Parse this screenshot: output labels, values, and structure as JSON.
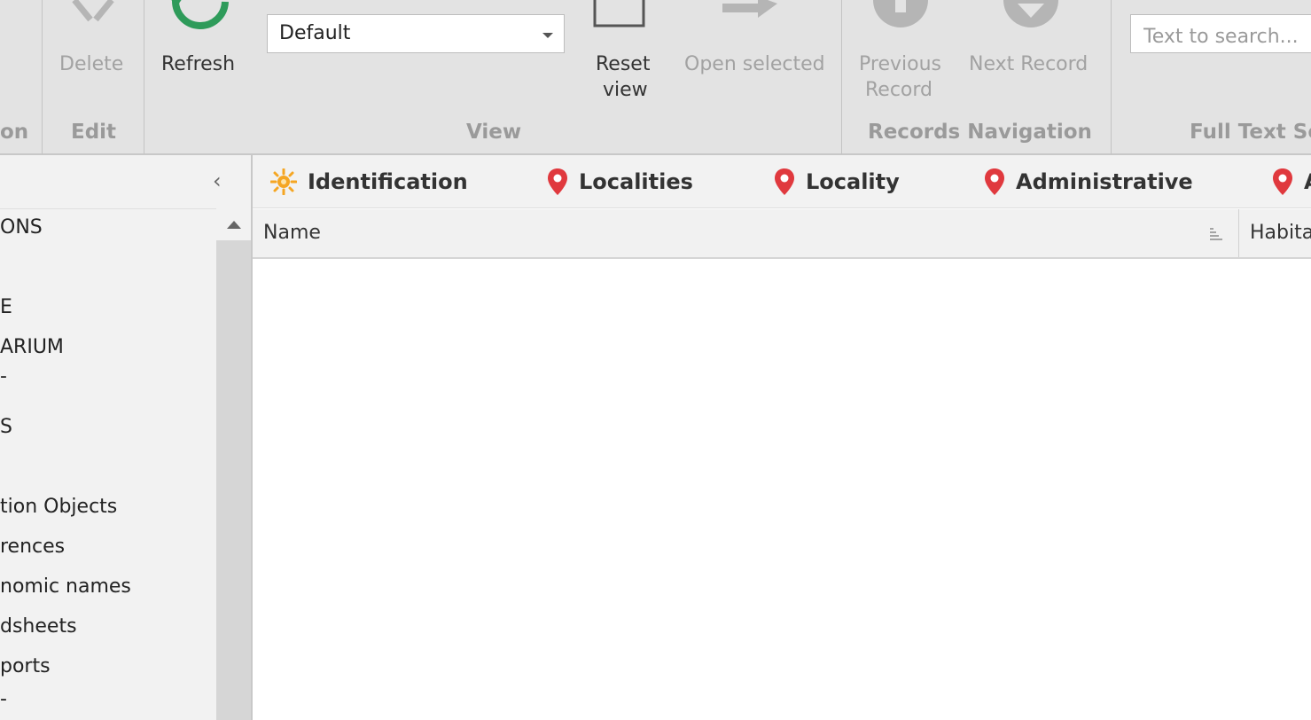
{
  "ribbon": {
    "buttons": {
      "delete": "Delete",
      "refresh": "Refresh",
      "reset_view_line1": "Reset",
      "reset_view_line2": "view",
      "open_selected": "Open selected",
      "previous_record_line1": "Previous",
      "previous_record_line2": "Record",
      "next_record": "Next Record"
    },
    "view_combo_value": "Default",
    "search_placeholder": "Text to search...",
    "groups": {
      "first": "on",
      "edit": "Edit",
      "view": "View",
      "records_navigation": "Records Navigation",
      "full_text_search": "Full Text Se"
    }
  },
  "sidebar": {
    "collapse_glyph": "‹",
    "items": [
      "ONS",
      "E",
      "ARIUM",
      "-",
      "S",
      "tion Objects",
      "rences",
      "nomic names",
      "dsheets",
      "ports",
      "-"
    ]
  },
  "tabs": [
    {
      "label": "Identification",
      "icon": "sun-icon"
    },
    {
      "label": "Localities",
      "icon": "map-pin-icon"
    },
    {
      "label": "Locality",
      "icon": "map-pin-icon"
    },
    {
      "label": "Administrative",
      "icon": "map-pin-icon"
    },
    {
      "label": "A",
      "icon": "map-pin-icon"
    }
  ],
  "grid": {
    "columns": [
      "Name",
      "Habita"
    ]
  },
  "colors": {
    "refresh_green": "#2e9b5a",
    "pin_red": "#e0393e",
    "sun_orange": "#f5a623",
    "disabled_icon": "#b5b5b5"
  }
}
